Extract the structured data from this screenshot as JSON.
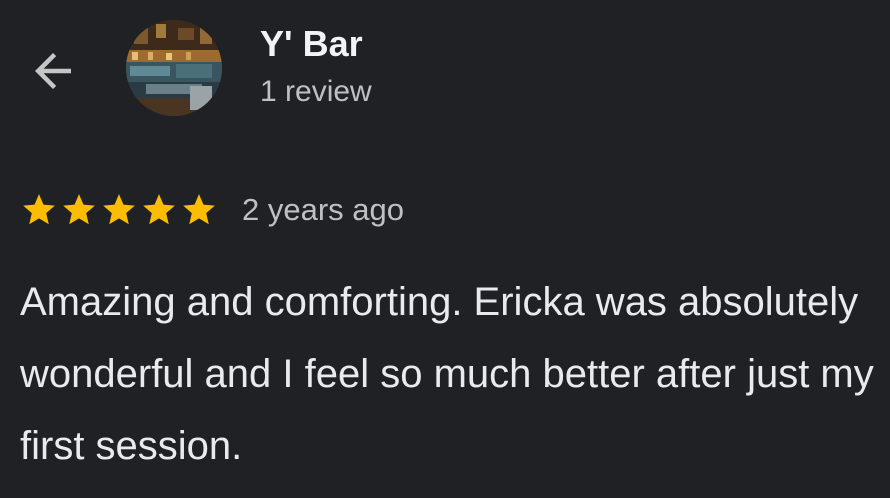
{
  "header": {
    "place_name": "Y' Bar",
    "review_count": "1 review",
    "back_icon": "arrow-left-icon",
    "avatar_alt": "place photo"
  },
  "review": {
    "rating": 5,
    "max_rating": 5,
    "star_color": "#fbbc04",
    "date": "2 years ago",
    "text": "Amazing and comforting. Ericka was absolutely wonderful and I feel so much better after just my first session."
  },
  "colors": {
    "background": "#202124",
    "primary_text": "#e8eaed",
    "secondary_text": "#bdc1c6"
  }
}
